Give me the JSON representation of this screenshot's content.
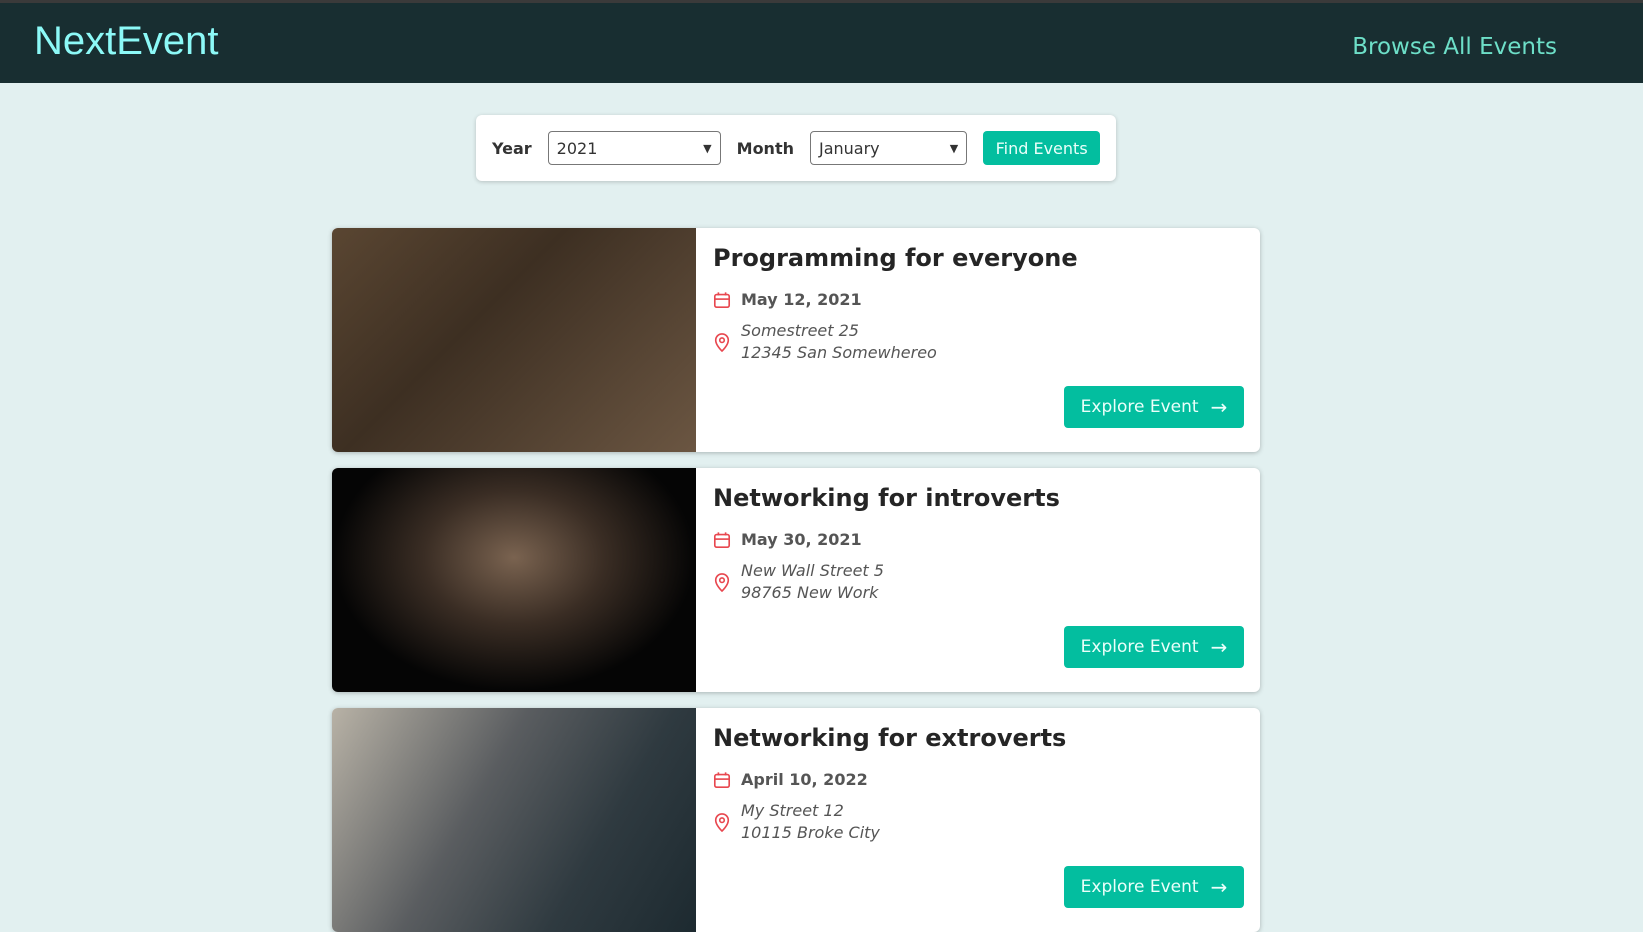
{
  "header": {
    "logo": "NextEvent",
    "browse_link": "Browse All Events"
  },
  "filter": {
    "year_label": "Year",
    "year_value": "2021",
    "month_label": "Month",
    "month_value": "January",
    "submit": "Find Events"
  },
  "events": [
    {
      "title": "Programming for everyone",
      "date": "May 12, 2021",
      "address_line1": "Somestreet 25",
      "address_line2": "12345 San Somewhereo",
      "button": "Explore Event"
    },
    {
      "title": "Networking for introverts",
      "date": "May 30, 2021",
      "address_line1": "New Wall Street 5",
      "address_line2": "98765 New Work",
      "button": "Explore Event"
    },
    {
      "title": "Networking for extroverts",
      "date": "April 10, 2022",
      "address_line1": "My Street 12",
      "address_line2": "10115 Broke City",
      "button": "Explore Event"
    }
  ],
  "colors": {
    "header": "#182e31",
    "accent": "#03be9f",
    "icon": "#e8474f"
  }
}
